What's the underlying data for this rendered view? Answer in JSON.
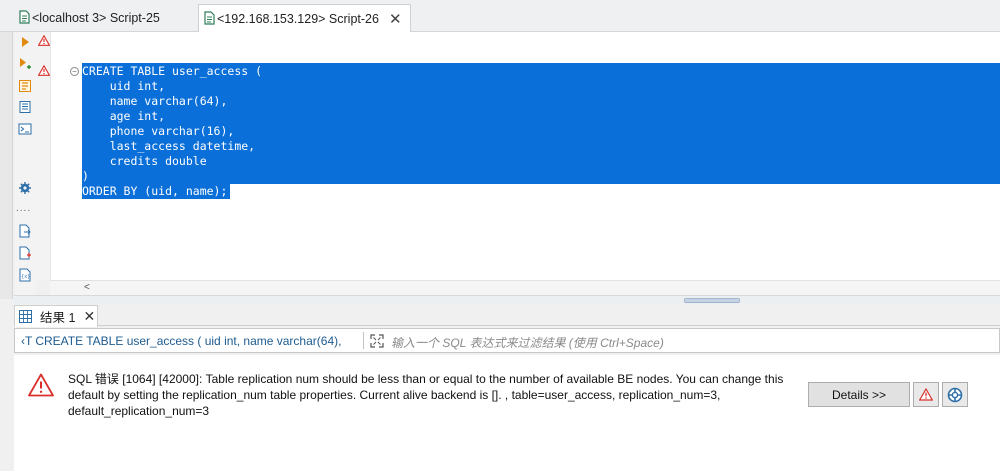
{
  "tabs": [
    {
      "label": "<localhost 3> Script-25",
      "active": false
    },
    {
      "label": "<192.168.153.129> Script-26",
      "active": true
    }
  ],
  "editor": {
    "lines": [
      "CREATE TABLE user_access (",
      "    uid int,",
      "    name varchar(64),",
      "    age int,",
      "    phone varchar(16),",
      "    last_access datetime,",
      "    credits double",
      ")",
      "ORDER BY (uid, name);"
    ],
    "scroll_left_glyph": "<"
  },
  "results": {
    "tab_label": "结果 1",
    "filter": {
      "sql_prefix": "‹T",
      "sql_text": "CREATE TABLE user_access ( uid int, name varchar(64),",
      "placeholder": "输入一个 SQL 表达式来过滤结果 (使用 Ctrl+Space)"
    },
    "error": {
      "message": "SQL 错误 [1064] [42000]: Table replication num should be less than or equal to the number of available BE nodes. You can change this default by setting the replication_num table properties. Current alive backend is []. , table=user_access, replication_num=3, default_replication_num=3",
      "details_label": "Details >>"
    }
  },
  "colors": {
    "selection": "#0a6fd8",
    "accent": "#1d5b8f",
    "error_red": "#d9302c"
  }
}
